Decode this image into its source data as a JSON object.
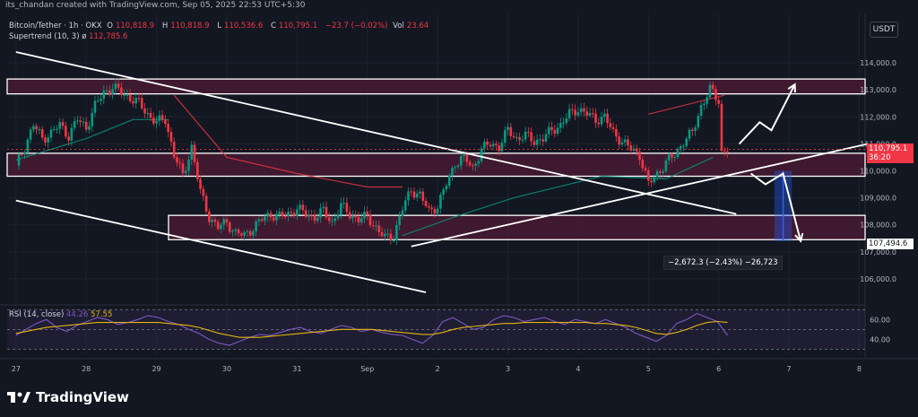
{
  "header": {
    "author_line": "its_chandan created with TradingView.com, Sep 05, 2025 22:53 UTC+5:30"
  },
  "legend": {
    "symbol": "Bitcoin/Tether · 1h · OKX",
    "open_label": "O",
    "open": "110,818.9",
    "high_label": "H",
    "high": "110,818.9",
    "low_label": "L",
    "low": "110,536.6",
    "close_label": "C",
    "close": "110,795.1",
    "change": "−23.7 (−0.02%)",
    "vol_label": "Vol",
    "vol": "23.64"
  },
  "supertrend": {
    "label": "Supertrend (10, 3)",
    "symbol": "ø",
    "value": "112,785.6"
  },
  "rsi_legend": {
    "label": "RSI (14, close)",
    "rsi": "44.26",
    "ma": "57.55"
  },
  "unit": "USDT",
  "price_tag": {
    "value": "110,795.1",
    "countdown": "36:20"
  },
  "target_tag": "107,494.6",
  "measure": "−2,672.3 (−2.43%) −26,723",
  "brand": "TradingView",
  "colors": {
    "bg": "#131722",
    "up": "#089981",
    "down": "#f23645",
    "zone": "#4a1a33",
    "rsi": "#7e57c2",
    "rsi_ma": "#e5b612",
    "measure": "#2962ff"
  },
  "chart_data": {
    "type": "candlestick",
    "title": "Bitcoin/Tether · 1h · OKX",
    "ylim": [
      105200,
      114500
    ],
    "y_ticks": [
      106000,
      107000,
      108000,
      109000,
      110000,
      111000,
      112000,
      113000,
      114000
    ],
    "y_tick_labels": [
      "106,000.0",
      "107,000.0",
      "108,000.0",
      "109,000.0",
      "110,000.0",
      "111,000.0",
      "112,000.0",
      "113,000.0",
      "114,000.0"
    ],
    "x_labels": [
      "27",
      "28",
      "29",
      "30",
      "31",
      "Sep",
      "2",
      "3",
      "4",
      "5",
      "6",
      "7",
      "8"
    ],
    "x_positions_hours": [
      0,
      24,
      48,
      72,
      96,
      120,
      144,
      168,
      192,
      216,
      240,
      264,
      288
    ],
    "close_path": [
      [
        0,
        110200
      ],
      [
        3,
        110900
      ],
      [
        6,
        111700
      ],
      [
        9,
        111200
      ],
      [
        12,
        111400
      ],
      [
        15,
        111700
      ],
      [
        18,
        111300
      ],
      [
        21,
        111900
      ],
      [
        24,
        111600
      ],
      [
        27,
        112400
      ],
      [
        30,
        112900
      ],
      [
        33,
        113100
      ],
      [
        36,
        112900
      ],
      [
        39,
        112700
      ],
      [
        42,
        112500
      ],
      [
        45,
        112100
      ],
      [
        48,
        111800
      ],
      [
        51,
        111900
      ],
      [
        54,
        110600
      ],
      [
        57,
        109800
      ],
      [
        60,
        110900
      ],
      [
        63,
        109200
      ],
      [
        66,
        108300
      ],
      [
        69,
        107900
      ],
      [
        72,
        108100
      ],
      [
        75,
        107700
      ],
      [
        78,
        107600
      ],
      [
        81,
        107900
      ],
      [
        84,
        108200
      ],
      [
        87,
        108400
      ],
      [
        90,
        108300
      ],
      [
        93,
        108400
      ],
      [
        96,
        108600
      ],
      [
        99,
        108400
      ],
      [
        102,
        108300
      ],
      [
        105,
        108500
      ],
      [
        108,
        108100
      ],
      [
        111,
        108700
      ],
      [
        114,
        108400
      ],
      [
        117,
        108200
      ],
      [
        120,
        108300
      ],
      [
        123,
        107900
      ],
      [
        126,
        107500
      ],
      [
        129,
        107600
      ],
      [
        132,
        108600
      ],
      [
        135,
        109300
      ],
      [
        138,
        109100
      ],
      [
        141,
        108500
      ],
      [
        144,
        108700
      ],
      [
        147,
        109500
      ],
      [
        150,
        110300
      ],
      [
        153,
        110500
      ],
      [
        156,
        110100
      ],
      [
        159,
        110800
      ],
      [
        162,
        111000
      ],
      [
        165,
        110900
      ],
      [
        168,
        111500
      ],
      [
        171,
        111200
      ],
      [
        174,
        111300
      ],
      [
        177,
        111100
      ],
      [
        180,
        111200
      ],
      [
        183,
        111500
      ],
      [
        186,
        111700
      ],
      [
        189,
        112100
      ],
      [
        192,
        112300
      ],
      [
        195,
        112100
      ],
      [
        198,
        111900
      ],
      [
        201,
        112000
      ],
      [
        204,
        111400
      ],
      [
        207,
        111100
      ],
      [
        210,
        110800
      ],
      [
        213,
        110600
      ],
      [
        216,
        109500
      ],
      [
        219,
        109900
      ],
      [
        222,
        110300
      ],
      [
        225,
        110600
      ],
      [
        228,
        111100
      ],
      [
        231,
        111400
      ],
      [
        234,
        112400
      ],
      [
        237,
        113000
      ],
      [
        240,
        112600
      ],
      [
        241,
        110700
      ],
      [
        243,
        110795
      ]
    ],
    "supertrend_up": [
      [
        0,
        110400
      ],
      [
        24,
        111200
      ],
      [
        40,
        111900
      ],
      [
        52,
        111900
      ]
    ],
    "supertrend_down": [
      [
        54,
        112800
      ],
      [
        72,
        110500
      ],
      [
        96,
        109900
      ],
      [
        120,
        109400
      ],
      [
        132,
        109400
      ]
    ],
    "supertrend_up2": [
      [
        132,
        107600
      ],
      [
        150,
        108300
      ],
      [
        170,
        109000
      ],
      [
        200,
        109800
      ],
      [
        222,
        109700
      ],
      [
        238,
        110500
      ]
    ],
    "supertrend_down2": [
      [
        216,
        112100
      ],
      [
        242,
        112800
      ]
    ],
    "zones": [
      {
        "from": 112850,
        "to": 113400
      },
      {
        "from": 109800,
        "to": 110650
      },
      {
        "from": 107450,
        "to": 108350
      }
    ],
    "lines": [
      {
        "x1": 0,
        "y1": 114400,
        "x2": 246,
        "y2": 108400
      },
      {
        "x1": 0,
        "y1": 108900,
        "x2": 140,
        "y2": 105500
      },
      {
        "x1": 135,
        "y1": 107200,
        "x2": 291,
        "y2": 111000
      }
    ],
    "projection_up": [
      [
        247,
        111000
      ],
      [
        254,
        111800
      ],
      [
        258,
        111500
      ],
      [
        266,
        113200
      ]
    ],
    "projection_down": [
      [
        251,
        109900
      ],
      [
        256,
        109500
      ],
      [
        262,
        109900
      ],
      [
        268,
        107400
      ]
    ],
    "measure_range": {
      "x_from": 259,
      "x_to": 265,
      "top": 110000,
      "bottom": 107400
    },
    "rsi": {
      "ylim": [
        25,
        72
      ],
      "ticks": [
        40,
        60
      ],
      "tick_labels": [
        "40.00",
        "60.00"
      ],
      "values": [
        44,
        50,
        56,
        60,
        52,
        48,
        54,
        58,
        62,
        60,
        55,
        57,
        60,
        64,
        62,
        58,
        55,
        50,
        46,
        40,
        36,
        34,
        38,
        42,
        45,
        44,
        47,
        50,
        52,
        48,
        46,
        50,
        54,
        52,
        48,
        50,
        47,
        45,
        44,
        40,
        36,
        44,
        58,
        62,
        56,
        50,
        52,
        60,
        64,
        62,
        58,
        60,
        62,
        58,
        55,
        60,
        58,
        56,
        60,
        56,
        52,
        46,
        42,
        38,
        44,
        56,
        60,
        66,
        62,
        58,
        44
      ],
      "ma_values": [
        46,
        48,
        50,
        52,
        53,
        54,
        55,
        56,
        57,
        57,
        57,
        57,
        57,
        57,
        57,
        56,
        55,
        54,
        52,
        49,
        46,
        44,
        42,
        42,
        42,
        43,
        44,
        45,
        46,
        47,
        48,
        49,
        50,
        50,
        50,
        50,
        49,
        48,
        47,
        46,
        45,
        45,
        47,
        50,
        52,
        53,
        54,
        55,
        56,
        56,
        57,
        57,
        57,
        57,
        57,
        57,
        57,
        56,
        56,
        55,
        54,
        52,
        49,
        46,
        45,
        47,
        50,
        54,
        57,
        58,
        57
      ]
    }
  }
}
